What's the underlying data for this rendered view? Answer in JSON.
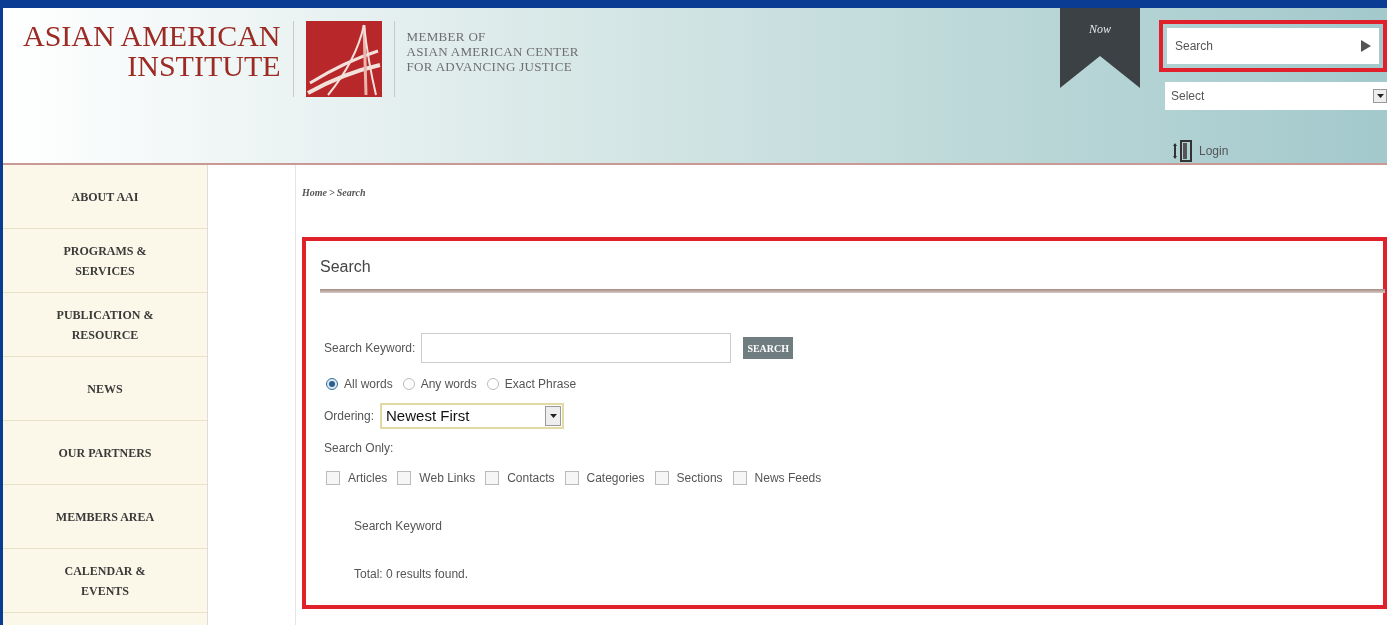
{
  "header": {
    "logo_lines": [
      "ASIAN AMERICAN",
      "INSTITUTE"
    ],
    "member_lines": [
      "MEMBER OF",
      "ASIAN AMERICAN CENTER",
      "FOR ADVANCING JUSTICE"
    ],
    "donate_ribbon": "Now",
    "search": {
      "placeholder": "Search",
      "highlighted": true
    },
    "select": {
      "value": "Select"
    },
    "login": "Login"
  },
  "sidebar": {
    "items": [
      {
        "label": "ABOUT AAI"
      },
      {
        "label": "PROGRAMS & SERVICES"
      },
      {
        "label": "PUBLICATION & RESOURCE"
      },
      {
        "label": "NEWS"
      },
      {
        "label": "OUR PARTNERS"
      },
      {
        "label": "MEMBERS AREA"
      },
      {
        "label": "CALENDAR & EVENTS"
      }
    ]
  },
  "breadcrumb": {
    "separator": ">",
    "items": [
      "Home",
      "Search"
    ]
  },
  "search_panel": {
    "highlighted": true,
    "title": "Search",
    "keyword_label": "Search Keyword:",
    "button": "SEARCH",
    "match_options": [
      {
        "label": "All words",
        "selected": true
      },
      {
        "label": "Any words",
        "selected": false
      },
      {
        "label": "Exact Phrase",
        "selected": false
      }
    ],
    "ordering_label": "Ordering:",
    "ordering_value": "Newest First",
    "search_only_label": "Search Only:",
    "areas": [
      {
        "label": "Articles",
        "checked": false
      },
      {
        "label": "Web Links",
        "checked": false
      },
      {
        "label": "Contacts",
        "checked": false
      },
      {
        "label": "Categories",
        "checked": false
      },
      {
        "label": "Sections",
        "checked": false
      },
      {
        "label": "News Feeds",
        "checked": false
      }
    ],
    "results_heading": "Search Keyword",
    "results_total": "Total: 0 results found."
  }
}
